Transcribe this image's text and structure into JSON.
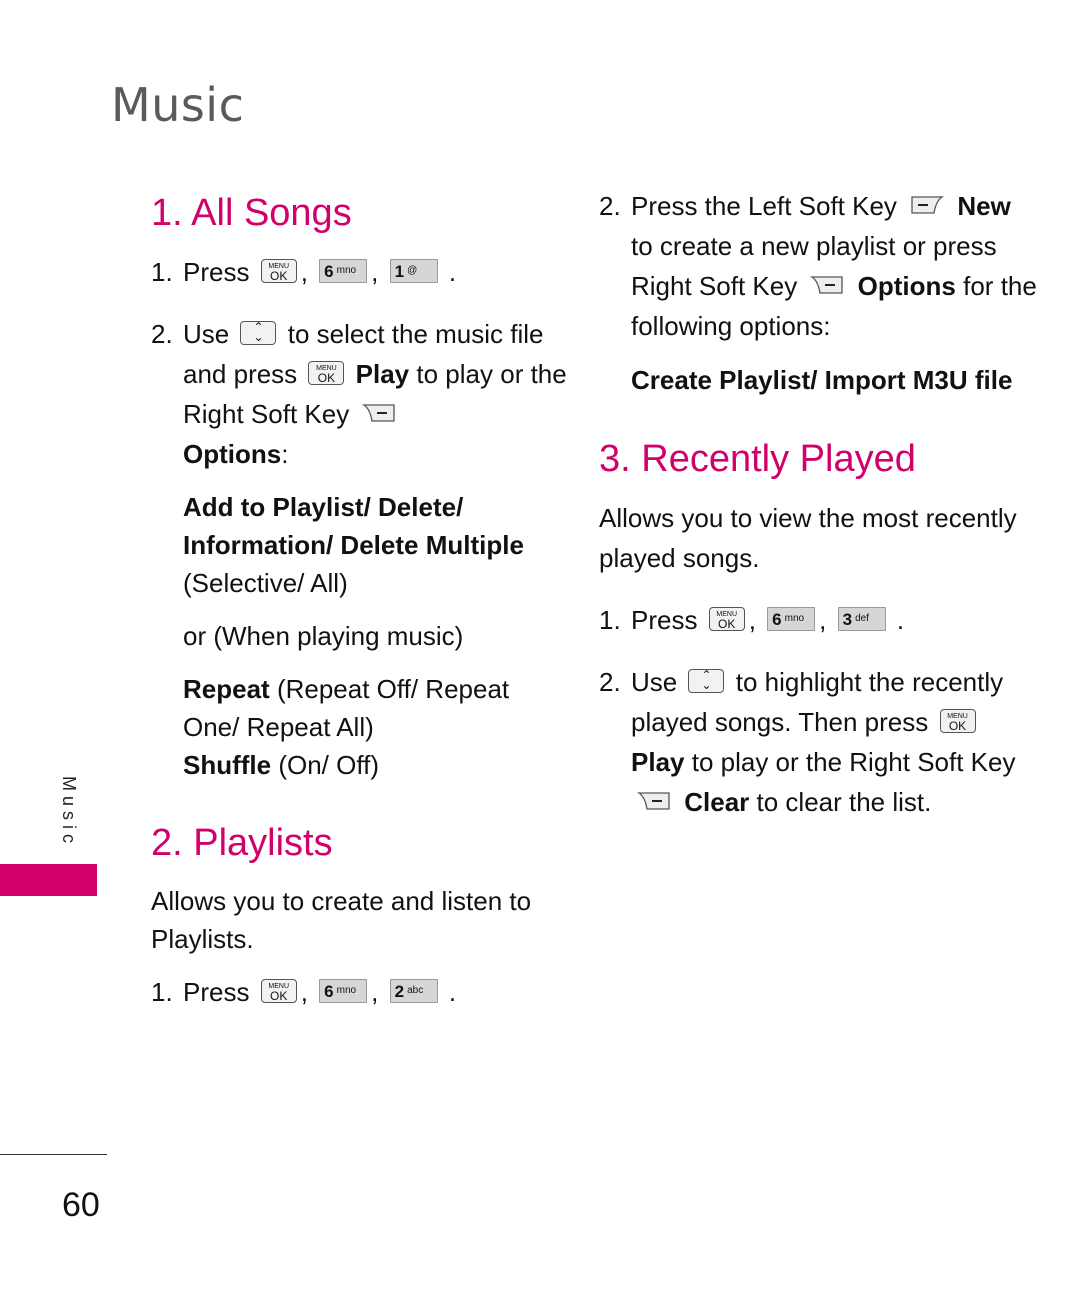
{
  "page": {
    "title": "Music",
    "side_tab": "Music",
    "page_number": "60",
    "accent_color": "#d1006b"
  },
  "keys": {
    "menu_ok": {
      "top": "MENU",
      "bottom": "OK"
    },
    "key6": {
      "digit": "6",
      "letters": "mno"
    },
    "key1": {
      "digit": "1",
      "letters": "@"
    },
    "key2": {
      "digit": "2",
      "letters": "abc"
    },
    "key3": {
      "digit": "3",
      "letters": "def"
    },
    "nav": {
      "up": "⌃",
      "down": "⌄"
    },
    "soft_minus": "−"
  },
  "sections": {
    "all_songs": {
      "heading": "1. All Songs",
      "step1": {
        "num": "1.",
        "text": "Press",
        "sep": ",",
        "end": "."
      },
      "step2": {
        "num": "2.",
        "use": "Use",
        "t1": "to select the music",
        "t2": "file and press",
        "play": "Play",
        "t3": "to play",
        "t4": "or the Right Soft Key",
        "options": "Options",
        "colon": ":"
      },
      "options_bold": "Add to Playlist/ Delete/ Information/ Delete Multiple",
      "options_rest": "(Selective/ All)",
      "when_playing": "or (When playing music)",
      "repeat_label": "Repeat",
      "repeat_values": "(Repeat Off/ Repeat One/ Repeat All)",
      "shuffle_label": "Shuffle",
      "shuffle_values": "(On/ Off)"
    },
    "playlists": {
      "heading": "2. Playlists",
      "description": "Allows you to create and listen to Playlists.",
      "step1": {
        "num": "1.",
        "text": "Press",
        "sep": ",",
        "end": "."
      },
      "step2": {
        "num": "2.",
        "t1": "Press the Left Soft Key",
        "new": "New",
        "t2": "to create a new playlist",
        "t3": "or press Right Soft Key",
        "options": "Options",
        "t4": "for the following options:"
      },
      "options_list": "Create Playlist/ Import M3U file"
    },
    "recently_played": {
      "heading": "3. Recently Played",
      "description": "Allows you to view the most recently played songs.",
      "step1": {
        "num": "1.",
        "text": "Press",
        "sep": ",",
        "end": "."
      },
      "step2": {
        "num": "2.",
        "use": "Use",
        "t1": "to highlight the recently played songs. Then press",
        "play": "Play",
        "t2": "to play or the Right Soft Key",
        "clear": "Clear",
        "t3": "to clear the list."
      }
    }
  }
}
